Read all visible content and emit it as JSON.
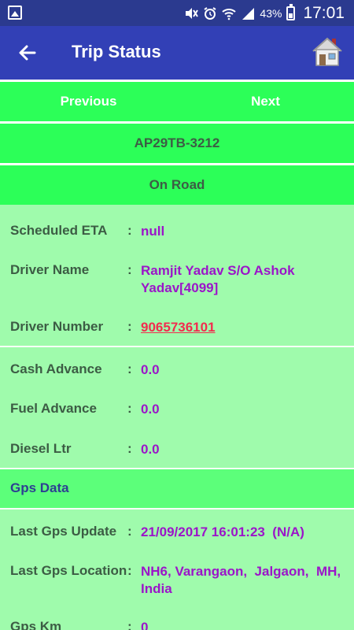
{
  "status_bar": {
    "battery": "43%",
    "time": "17:01",
    "icons": [
      "gallery-icon",
      "mute-icon",
      "alarm-icon",
      "wifi-icon",
      "signal-icon",
      "battery-icon"
    ]
  },
  "app_bar": {
    "title": "Trip Status",
    "back_icon": "back-arrow-icon",
    "home_icon": "home-icon"
  },
  "nav": {
    "previous": "Previous",
    "next": "Next"
  },
  "vehicle": {
    "number": "AP29TB-3212",
    "status": "On Road"
  },
  "details": [
    {
      "label": "Scheduled ETA",
      "value": "null"
    },
    {
      "label": "Driver Name",
      "value": "Ramjit Yadav S/O Ashok Yadav[4099]"
    },
    {
      "label": "Driver Number",
      "value": "9065736101"
    }
  ],
  "advances": [
    {
      "label": "Cash Advance",
      "value": "0.0"
    },
    {
      "label": "Fuel Advance",
      "value": "0.0"
    },
    {
      "label": "Diesel Ltr",
      "value": "0.0"
    }
  ],
  "gps": {
    "heading": "Gps Data",
    "rows": [
      {
        "label": "Last Gps Update",
        "value": "21/09/2017 16:01:23  (N/A)"
      },
      {
        "label": "Last Gps Location",
        "value": "NH6, Varangaon,  Jalgaon,  MH, India"
      },
      {
        "label": "Gps Km",
        "value": "0"
      }
    ]
  },
  "colon": ":",
  "colors": {
    "status_bar": "#2b3a8f",
    "app_bar": "#3240b6",
    "band": "#2cff58",
    "background": "#9ffbac",
    "value": "#9b15c9",
    "link": "#f22c4e"
  }
}
